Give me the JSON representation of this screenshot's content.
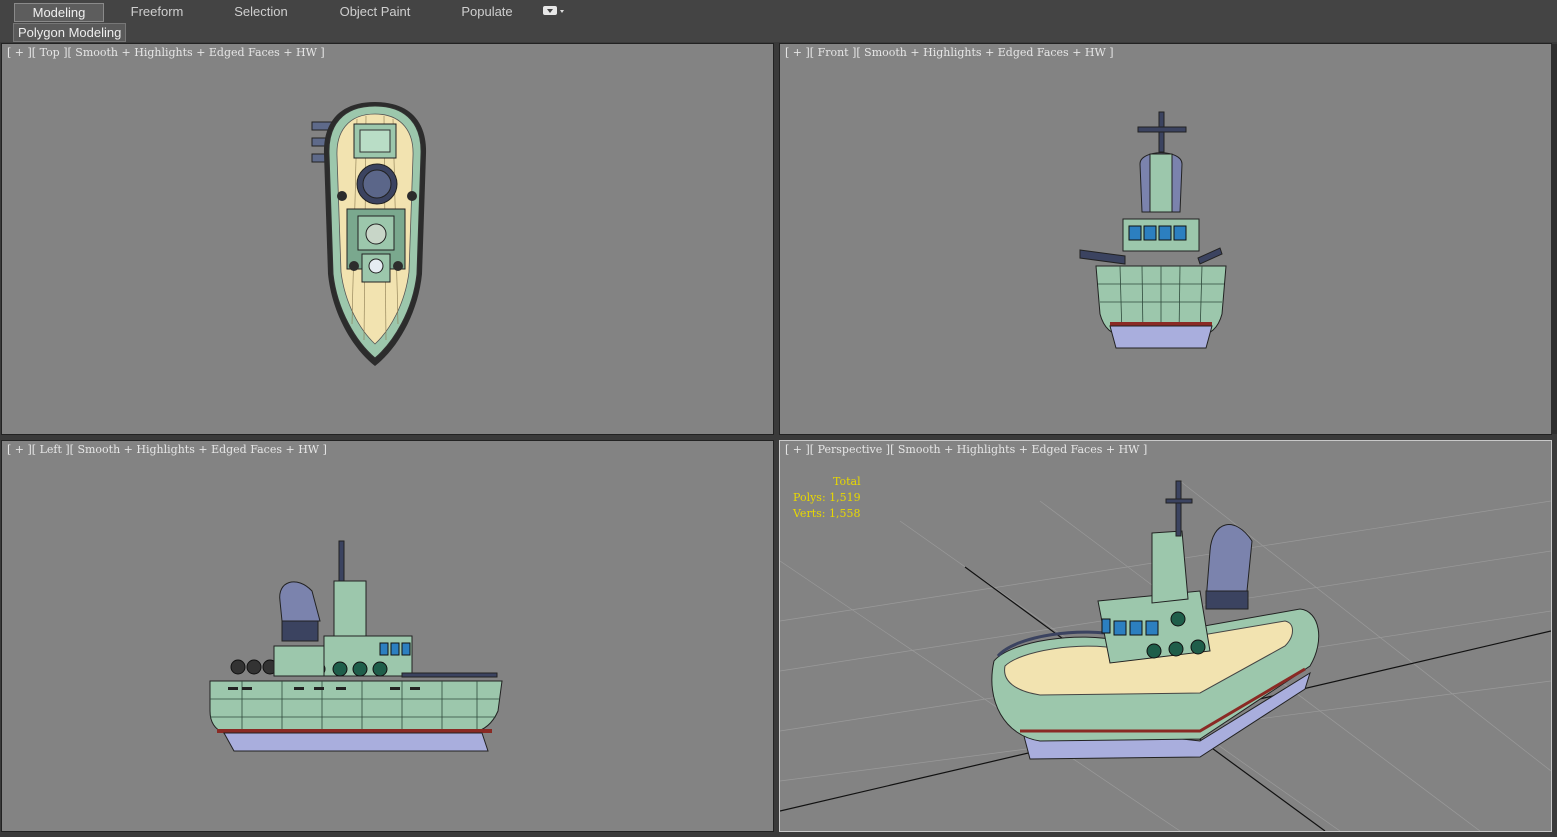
{
  "ribbon": {
    "tabs": [
      {
        "label": "Modeling",
        "active": true
      },
      {
        "label": "Freeform",
        "active": false
      },
      {
        "label": "Selection",
        "active": false
      },
      {
        "label": "Object Paint",
        "active": false
      },
      {
        "label": "Populate",
        "active": false
      }
    ],
    "menu_icon": "dropdown-icon",
    "panel_tab": "Polygon Modeling"
  },
  "viewports": {
    "top": {
      "label": "[ + ][ Top ][ Smooth + Highlights + Edged Faces + HW ]"
    },
    "front": {
      "label": "[ + ][ Front ][ Smooth + Highlights + Edged Faces + HW ]"
    },
    "left": {
      "label": "[ + ][ Left ][ Smooth + Highlights + Edged Faces + HW ]"
    },
    "perspective": {
      "label": "[ + ][ Perspective ][ Smooth + Highlights + Edged Faces + HW ]"
    }
  },
  "stats": {
    "title": "Total",
    "polys": "Polys: 1,519",
    "verts": "Verts: 1,558"
  },
  "colors": {
    "viewport_bg": "#838383",
    "hull_green": "#9cc7ac",
    "deck_wood": "#f2e3b0",
    "keel_lavender": "#a9aedd",
    "stripe_red": "#8a2a24",
    "stats_yellow": "#e8d800"
  }
}
